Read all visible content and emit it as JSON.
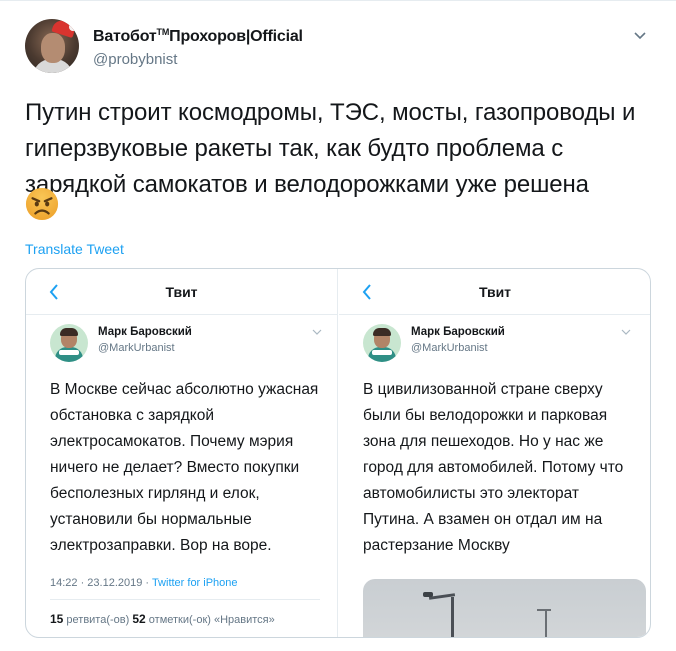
{
  "author": {
    "name": "ВатоботПрохоров|Official",
    "name_prefix": "Ватобот",
    "name_tm": "TM",
    "name_suffix": "Прохоров|Official",
    "handle": "@probybnist"
  },
  "tweet": {
    "text": "Путин строит космодромы, ТЭС, мосты, газопроводы и гиперзвуковые ракеты так, как будто проблема с зарядкой самокатов и велодорожками уже решена",
    "emoji": "angry-face-emoji",
    "translate_label": "Translate Tweet"
  },
  "embed": {
    "left": {
      "title": "Твит",
      "author_name": "Марк Баровский",
      "author_handle": "@MarkUrbanist",
      "text": "В Москве сейчас абсолютно ужасная обстановка с зарядкой электросамокатов. Почему мэрия ничего не делает? Вместо покупки бесполезных гирлянд и елок, установили бы нормальные электрозаправки. Вор на воре.",
      "timestamp": "14:22 · 23.12.2019 · ",
      "source": "Twitter for iPhone",
      "retweets_count": "15",
      "retweets_label": " ретвита(-ов) ",
      "likes_count": "52",
      "likes_label": " отметки(-ок) «Нравится»"
    },
    "right": {
      "title": "Твит",
      "author_name": "Марк Баровский",
      "author_handle": "@MarkUrbanist",
      "text": "В цивилизованной стране сверху были бы велодорожки и парковая зона для пешеходов. Но у нас же город для автомобилей. Потому что автомобилисты это электорат Путина. А взамен он отдал им на растерзание Москву"
    }
  },
  "colors": {
    "accent": "#1da1f2",
    "text": "#14171a",
    "muted": "#657786",
    "border": "#ccd6dd"
  }
}
